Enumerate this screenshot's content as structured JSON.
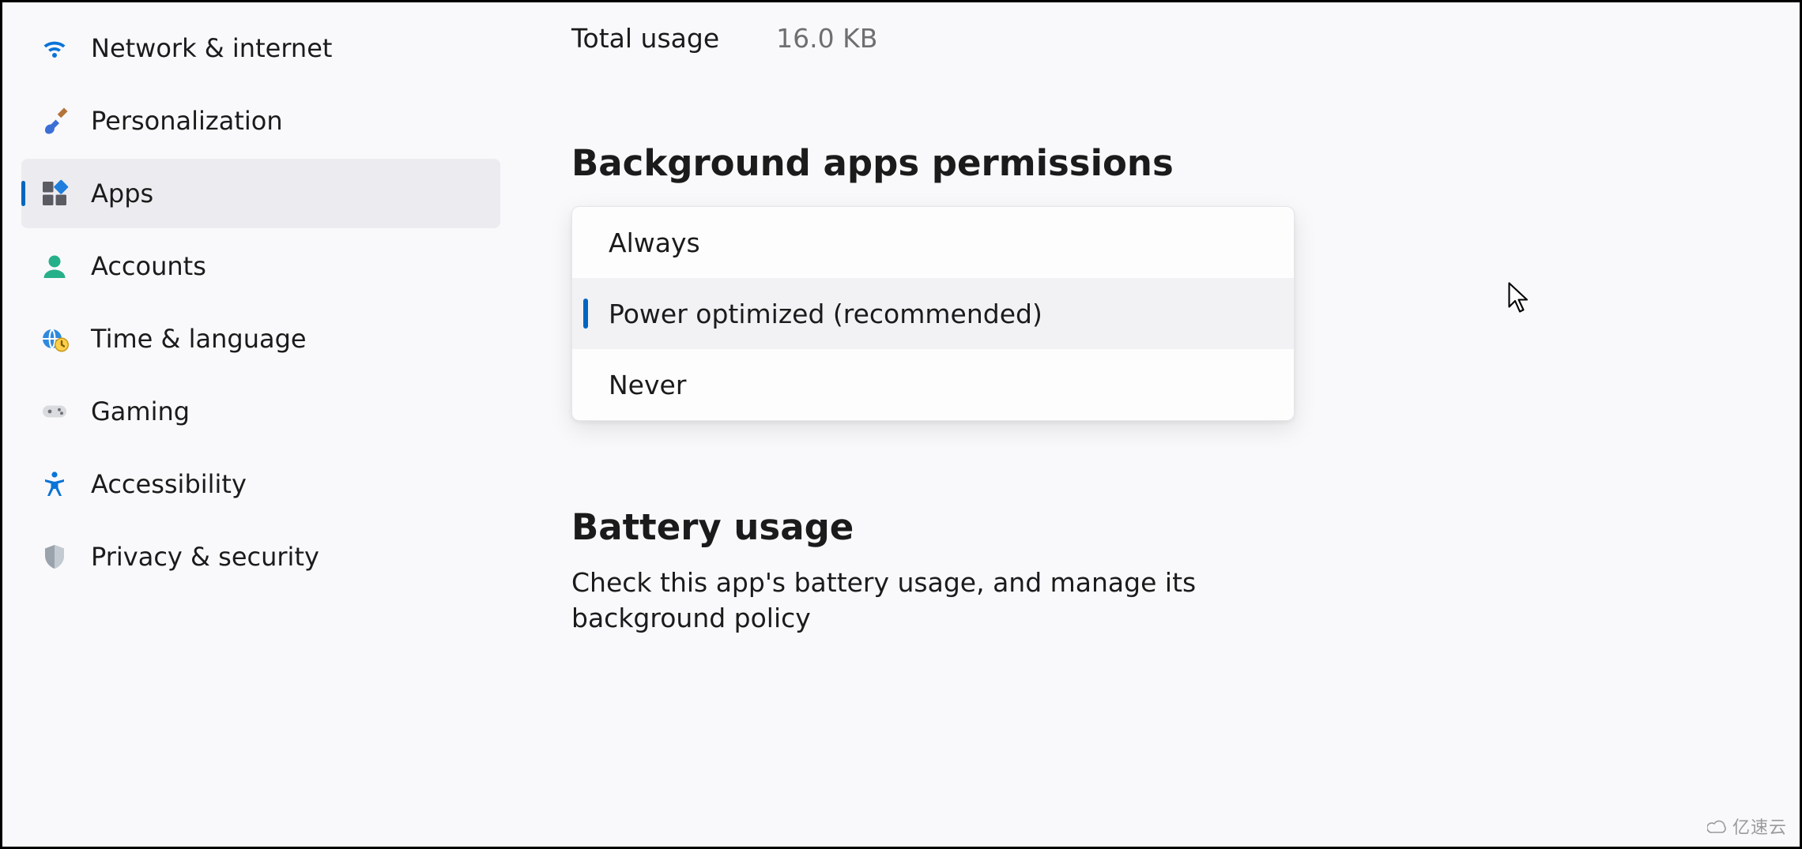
{
  "sidebar": {
    "items": [
      {
        "icon": "wifi-icon",
        "label": "Network & internet",
        "selected": false
      },
      {
        "icon": "paintbrush-icon",
        "label": "Personalization",
        "selected": false
      },
      {
        "icon": "apps-icon",
        "label": "Apps",
        "selected": true
      },
      {
        "icon": "person-icon",
        "label": "Accounts",
        "selected": false
      },
      {
        "icon": "globe-clock-icon",
        "label": "Time & language",
        "selected": false
      },
      {
        "icon": "gamepad-icon",
        "label": "Gaming",
        "selected": false
      },
      {
        "icon": "accessibility-icon",
        "label": "Accessibility",
        "selected": false
      },
      {
        "icon": "shield-icon",
        "label": "Privacy & security",
        "selected": false
      }
    ]
  },
  "main": {
    "usage": {
      "label": "Total usage",
      "value": "16.0 KB"
    },
    "background_permissions": {
      "heading": "Background apps permissions",
      "options": [
        {
          "label": "Always",
          "selected": false
        },
        {
          "label": "Power optimized (recommended)",
          "selected": true
        },
        {
          "label": "Never",
          "selected": false
        }
      ]
    },
    "battery": {
      "heading": "Battery usage",
      "description": "Check this app's battery usage, and manage its background policy"
    }
  },
  "watermark": "亿速云"
}
